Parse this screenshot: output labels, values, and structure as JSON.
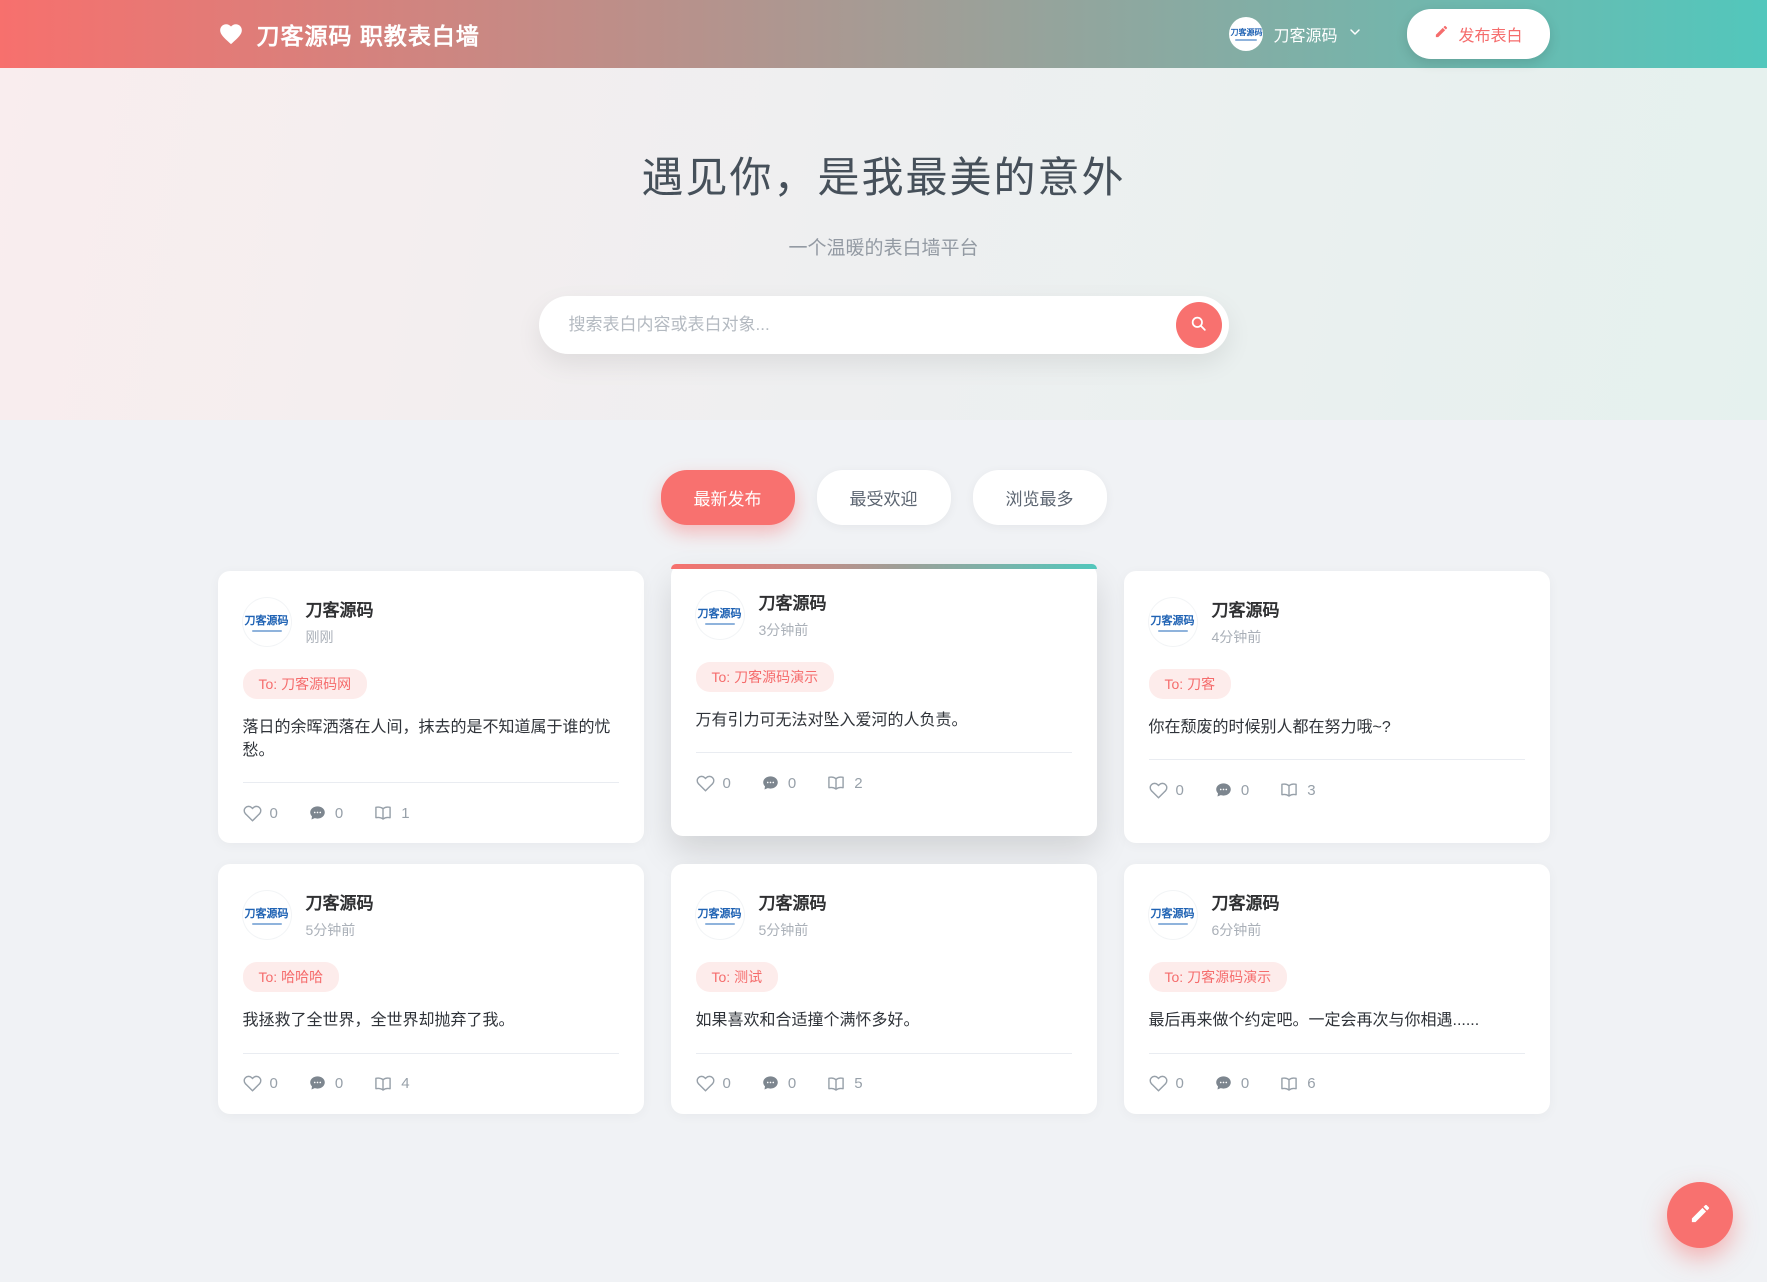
{
  "header": {
    "title": "刀客源码 职教表白墙",
    "user_name": "刀客源码",
    "publish_label": "发布表白",
    "avatar_logo_text": "刀客源码"
  },
  "hero": {
    "title": "遇见你，是我最美的意外",
    "subtitle": "一个温暖的表白墙平台",
    "search_placeholder": "搜索表白内容或表白对象...",
    "search_value": ""
  },
  "tabs": [
    {
      "label": "最新发布",
      "active": true
    },
    {
      "label": "最受欢迎",
      "active": false
    },
    {
      "label": "浏览最多",
      "active": false
    }
  ],
  "cards": [
    {
      "author": "刀客源码",
      "time": "刚刚",
      "to": "To: 刀客源码网",
      "content": "落日的余晖洒落在人间，抹去的是不知道属于谁的忧愁。",
      "likes": "0",
      "comments": "0",
      "views": "1",
      "highlighted": false
    },
    {
      "author": "刀客源码",
      "time": "3分钟前",
      "to": "To: 刀客源码演示",
      "content": "万有引力可无法对坠入爱河的人负责。",
      "likes": "0",
      "comments": "0",
      "views": "2",
      "highlighted": true
    },
    {
      "author": "刀客源码",
      "time": "4分钟前",
      "to": "To: 刀客",
      "content": "你在颓废的时候别人都在努力哦~?",
      "likes": "0",
      "comments": "0",
      "views": "3",
      "highlighted": false
    },
    {
      "author": "刀客源码",
      "time": "5分钟前",
      "to": "To: 哈哈哈",
      "content": "我拯救了全世界，全世界却抛弃了我。",
      "likes": "0",
      "comments": "0",
      "views": "4",
      "highlighted": false
    },
    {
      "author": "刀客源码",
      "time": "5分钟前",
      "to": "To: 测试",
      "content": "如果喜欢和合适撞个满怀多好。",
      "likes": "0",
      "comments": "0",
      "views": "5",
      "highlighted": false
    },
    {
      "author": "刀客源码",
      "time": "6分钟前",
      "to": "To: 刀客源码演示",
      "content": "最后再来做个约定吧。一定会再次与你相遇......",
      "likes": "0",
      "comments": "0",
      "views": "6",
      "highlighted": false
    }
  ],
  "icons": {
    "brand": "heart-icon",
    "publish": "pencil-icon",
    "search": "magnifier-icon",
    "user_menu": "chevron-down-icon",
    "like": "heart-outline-icon",
    "comment": "chat-bubble-icon",
    "views": "open-book-icon",
    "fab": "pencil-icon"
  },
  "colors": {
    "accent_coral": "#f8716f",
    "accent_teal": "#52c7bc",
    "badge_bg": "#fdeceb",
    "badge_text": "#f56c6c",
    "page_bg": "#f0f2f5"
  }
}
